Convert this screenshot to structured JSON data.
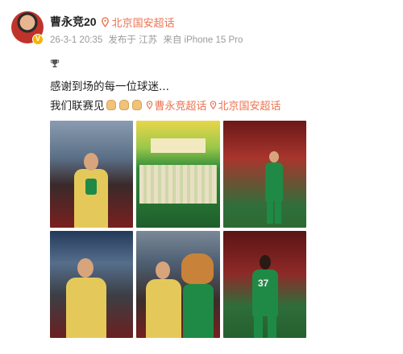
{
  "post": {
    "username": "曹永竞20",
    "topic": "北京国安超话",
    "timestamp": "26-3-1 20:35",
    "published_in": "发布于 江苏",
    "source": "来自 iPhone 15 Pro",
    "line1": "感谢到场的每一位球迷...",
    "line2_text": "我们联赛见",
    "hashtag1": "曹永竞超话",
    "hashtag2": "北京国安超话",
    "photo3_number": "37"
  },
  "icons": {
    "verified": "verified-badge",
    "pin": "location-pin-icon",
    "trophy": "trophy-icon",
    "emoji": "fist-emoji"
  },
  "colors": {
    "accent": "#eb7350",
    "meta": "#9a9a9a",
    "text": "#222222",
    "verified": "#f5b400"
  },
  "photos": [
    {
      "id": 1,
      "subject": "player-with-trophy-stadium"
    },
    {
      "id": 2,
      "subject": "team-celebration-stage"
    },
    {
      "id": 3,
      "subject": "player-walking-pitch"
    },
    {
      "id": 4,
      "subject": "player-with-phone-stadium"
    },
    {
      "id": 5,
      "subject": "player-with-mascot"
    },
    {
      "id": 6,
      "subject": "player-37-back-view"
    }
  ]
}
